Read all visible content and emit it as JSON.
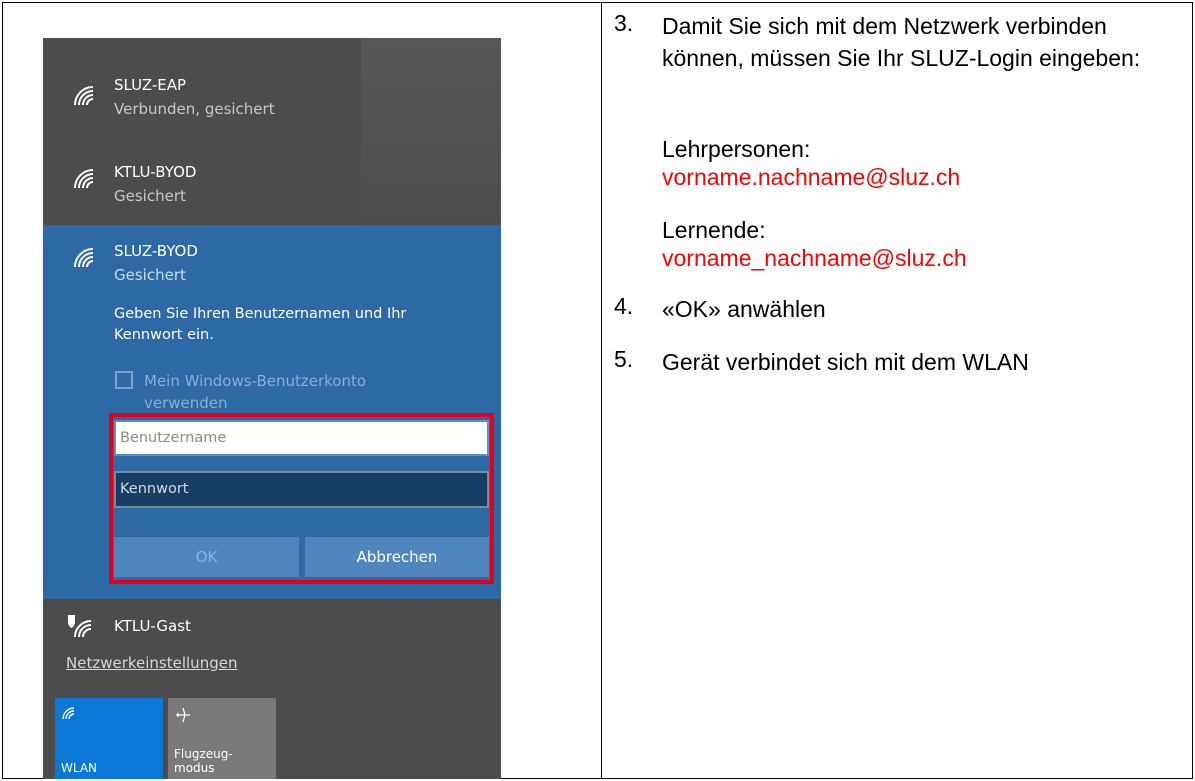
{
  "networks": [
    {
      "name": "SLUZ-EAP",
      "status": "Verbunden, gesichert"
    },
    {
      "name": "KTLU-BYOD",
      "status": "Gesichert"
    }
  ],
  "selected": {
    "name": "SLUZ-BYOD",
    "status": "Gesichert",
    "prompt": "Geben Sie Ihren Benutzernamen und Ihr Kennwort ein.",
    "checkbox_label": "Mein Windows-Benutzerkonto verwenden",
    "username_placeholder": "Benutzername",
    "password_placeholder": "Kennwort",
    "ok_label": "OK",
    "cancel_label": "Abbrechen",
    "highlight_color": "#e3001b"
  },
  "guest": {
    "name": "KTLU-Gast"
  },
  "settings_link": "Netzwerkeinstellungen",
  "tiles": [
    {
      "label": "WLAN",
      "icon": "wifi-icon",
      "active": true
    },
    {
      "label": "Flugzeug-\nmodus",
      "icon": "airplane-icon",
      "active": false
    }
  ],
  "steps": {
    "s3": {
      "num": "3.",
      "text": "Damit Sie sich mit dem Netzwerk verbinden können, müssen Sie Ihr SLUZ-Login eingeben:"
    },
    "teachers_label": "Lehrpersonen:",
    "teachers_value": "vorname.nachname@sluz.ch",
    "learners_label": "Lernende:",
    "learners_value": "vorname_nachname@sluz.ch",
    "s4": {
      "num": "4.",
      "text": "«OK» anwählen"
    },
    "s5": {
      "num": "5.",
      "text": "Gerät verbindet sich mit dem WLAN"
    }
  }
}
